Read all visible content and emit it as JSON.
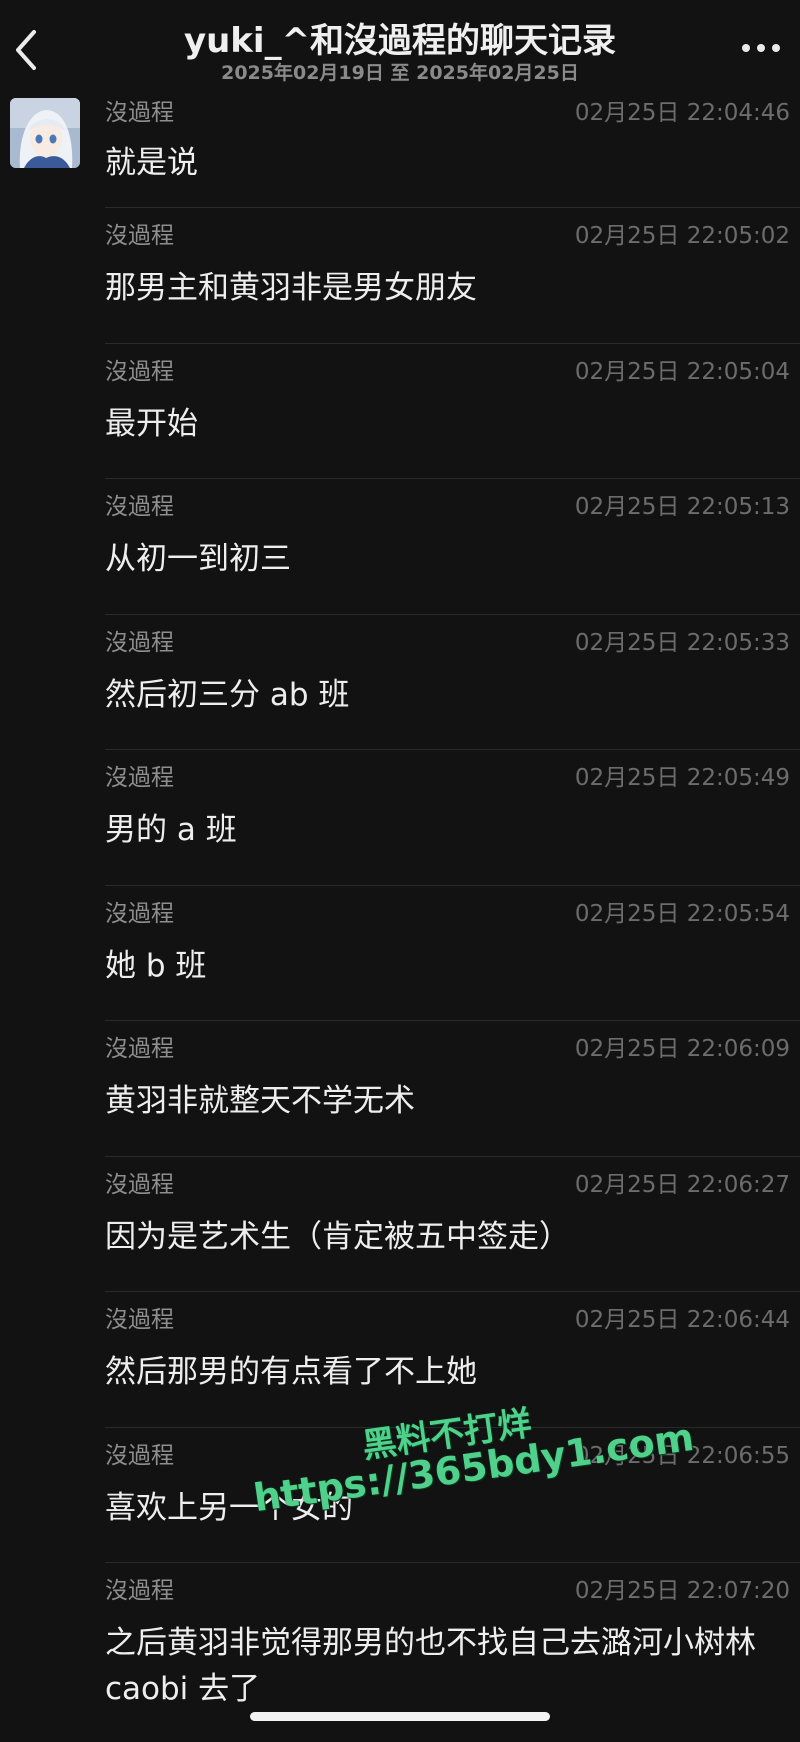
{
  "header": {
    "back_icon": "chevron-left-icon",
    "title": "yuki_^和沒過程的聊天记录",
    "subtitle": "2025年02月19日 至 2025年02月25日",
    "more_icon": "ellipsis-icon"
  },
  "messages": [
    {
      "sender": "沒過程",
      "time": "02月25日 22:04:46",
      "text": "就是说"
    },
    {
      "sender": "沒過程",
      "time": "02月25日 22:05:02",
      "text": "那男主和黄羽非是男女朋友"
    },
    {
      "sender": "沒過程",
      "time": "02月25日 22:05:04",
      "text": "最开始"
    },
    {
      "sender": "沒過程",
      "time": "02月25日 22:05:13",
      "text": "从初一到初三"
    },
    {
      "sender": "沒過程",
      "time": "02月25日 22:05:33",
      "text": "然后初三分 ab 班"
    },
    {
      "sender": "沒過程",
      "time": "02月25日 22:05:49",
      "text": "男的 a 班"
    },
    {
      "sender": "沒過程",
      "time": "02月25日 22:05:54",
      "text": "她 b 班"
    },
    {
      "sender": "沒過程",
      "time": "02月25日 22:06:09",
      "text": "黄羽非就整天不学无术"
    },
    {
      "sender": "沒過程",
      "time": "02月25日 22:06:27",
      "text": "因为是艺术生（肯定被五中签走）"
    },
    {
      "sender": "沒過程",
      "time": "02月25日 22:06:44",
      "text": "然后那男的有点看了不上她"
    },
    {
      "sender": "沒過程",
      "time": "02月25日 22:06:55",
      "text": "喜欢上另一个女的"
    },
    {
      "sender": "沒過程",
      "time": "02月25日 22:07:20",
      "text": "之后黄羽非觉得那男的也不找自己去潞河小树林 caobi 去了"
    }
  ],
  "watermark": {
    "line1": "黑料不打烊",
    "line2": "https://365bdy1.com"
  },
  "colors": {
    "background": "#121212",
    "text": "#eeeeee",
    "sender": "#8e8e8e",
    "time": "#6c6c6c",
    "watermark": "#4fd08b"
  }
}
